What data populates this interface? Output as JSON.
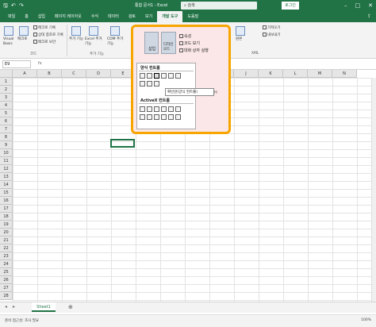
{
  "titlebar": {
    "doc_title": "통합 문서1 - Excel",
    "search_placeholder": "검색",
    "login": "로그인",
    "autosave_icon": "save-icon",
    "undo_icon": "undo-icon",
    "redo_icon": "redo-icon"
  },
  "tabs": [
    {
      "label": "파일"
    },
    {
      "label": "홈"
    },
    {
      "label": "삽입"
    },
    {
      "label": "페이지 레이아웃"
    },
    {
      "label": "수식"
    },
    {
      "label": "데이터"
    },
    {
      "label": "검토"
    },
    {
      "label": "보기"
    },
    {
      "label": "개발 도구",
      "active": true
    },
    {
      "label": "도움말"
    }
  ],
  "ribbon": {
    "code": {
      "visual_basic": "Visual Basic",
      "macro": "매크로",
      "record_macro": "매크로 기록",
      "relative_ref": "상대 참조로 기록",
      "macro_security": "매크로 보안",
      "group_label": "코드"
    },
    "addins": {
      "addins": "추가 기능",
      "excel_addins": "Excel 추가 기능",
      "com_addins": "COM 추가 기능",
      "group_label": "추가 기능"
    },
    "xml": {
      "source": "원본",
      "group_label": "XML",
      "import": "가져오기",
      "export": "내보내기"
    }
  },
  "formula_bar": {
    "namebox": "E9",
    "fx": "fx"
  },
  "dropdown": {
    "insert_label": "삽입",
    "design_label": "디자인 모드",
    "properties": "속성",
    "view_code": "코드 보기",
    "run_dialog": "대화 상자 실행",
    "form_controls_title": "양식 컨트롤",
    "activex_title": "ActiveX 컨트롤",
    "tooltip": "확인란(양식 컨트롤)",
    "pane_label": "H"
  },
  "columns": [
    "A",
    "B",
    "C",
    "D",
    "E",
    "F",
    "G",
    "H",
    "I",
    "J",
    "K",
    "L",
    "M",
    "N"
  ],
  "rows": [
    "1",
    "2",
    "3",
    "4",
    "5",
    "6",
    "7",
    "8",
    "9",
    "10",
    "11",
    "12",
    "13",
    "14",
    "15",
    "16",
    "17",
    "18",
    "19",
    "20",
    "21",
    "22",
    "23",
    "24",
    "25",
    "26",
    "27",
    "28"
  ],
  "sheet": {
    "tab": "Sheet1",
    "add": "⊕"
  },
  "status": {
    "text": "준비 접근성: 조사 필요",
    "zoom": "100%"
  }
}
